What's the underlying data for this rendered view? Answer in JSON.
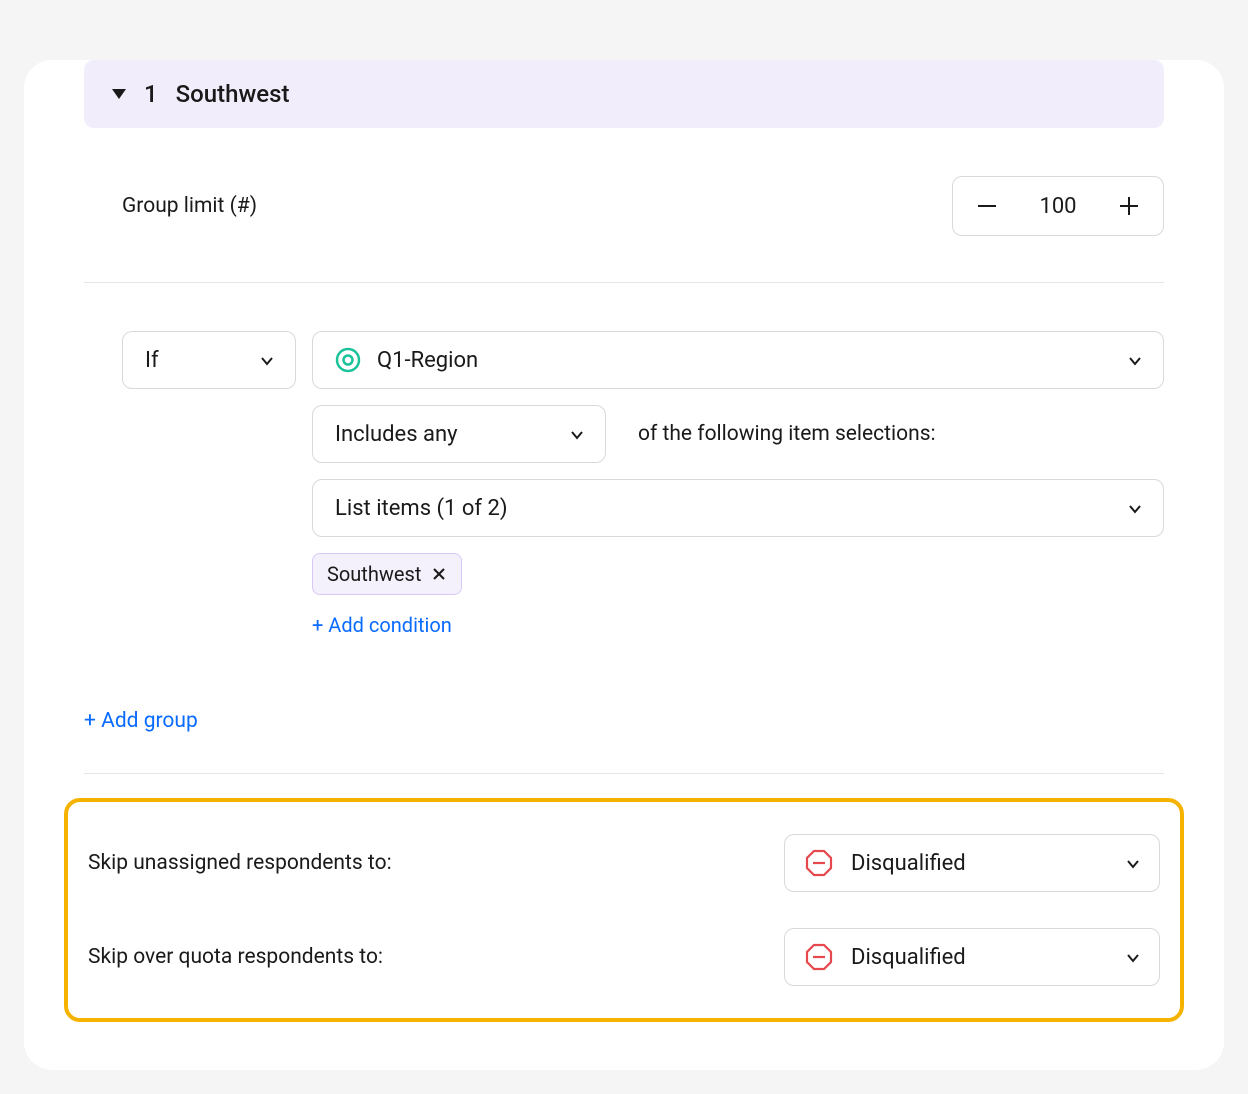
{
  "group": {
    "number": "1",
    "title": "Southwest"
  },
  "group_limit": {
    "label": "Group limit (#)",
    "value": "100"
  },
  "condition": {
    "if_label": "If",
    "question": "Q1-Region",
    "operator": "Includes any",
    "of_text": "of the following item selections:",
    "list_items": "List items (1 of 2)",
    "chip": "Southwest",
    "add_condition": "+ Add condition"
  },
  "add_group": "+ Add group",
  "skip": {
    "unassigned_label": "Skip unassigned respondents to:",
    "unassigned_value": "Disqualified",
    "overquota_label": "Skip over quota respondents to:",
    "overquota_value": "Disqualified"
  }
}
